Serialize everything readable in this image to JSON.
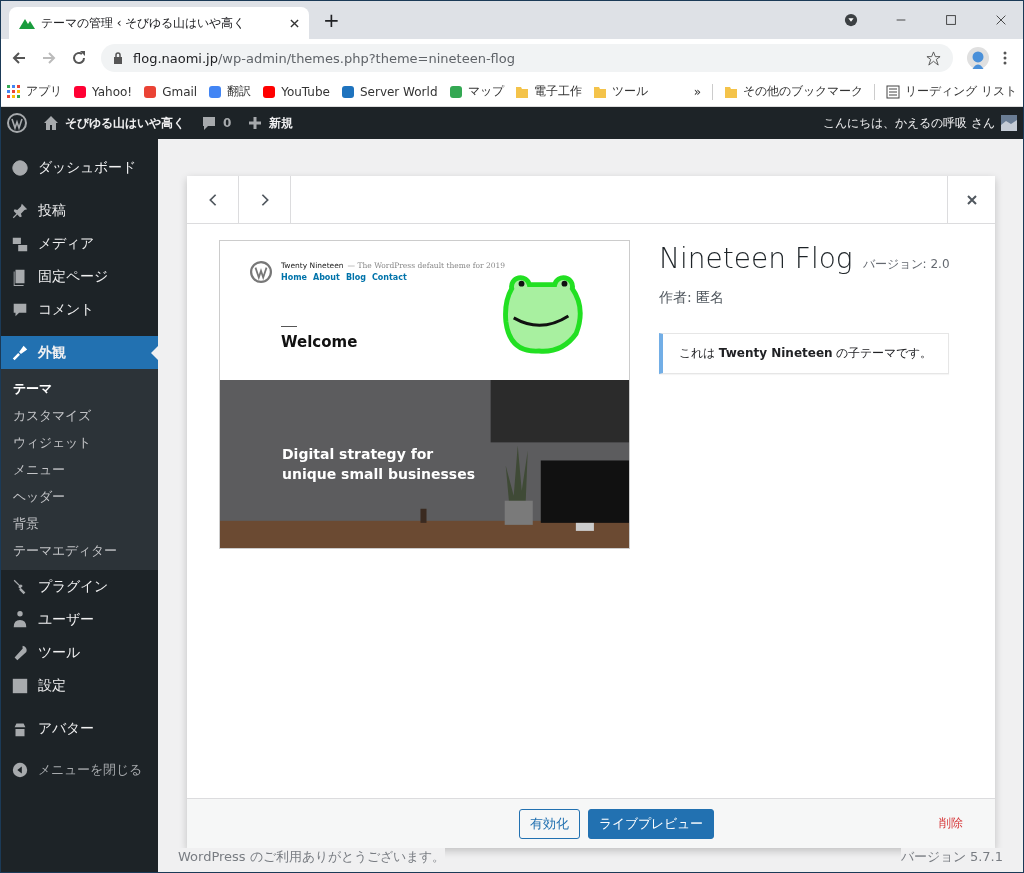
{
  "browser": {
    "tab_title": "テーマの管理 ‹ そびゆる山はいや高く",
    "new_tab": "+",
    "url_host": "flog.naomi.jp",
    "url_path": "/wp-admin/themes.php?theme=nineteen-flog",
    "bookmarks": [
      {
        "label": "アプリ",
        "kind": "apps"
      },
      {
        "label": "Yahoo!",
        "kind": "site",
        "color": "#ff0033"
      },
      {
        "label": "Gmail",
        "kind": "site",
        "color": "#ea4335"
      },
      {
        "label": "翻訳",
        "kind": "site",
        "color": "#4285f4"
      },
      {
        "label": "YouTube",
        "kind": "site",
        "color": "#ff0000"
      },
      {
        "label": "Server World",
        "kind": "site",
        "color": "#1e73be"
      },
      {
        "label": "マップ",
        "kind": "site",
        "color": "#34a853"
      },
      {
        "label": "電子工作",
        "kind": "folder"
      },
      {
        "label": "ツール",
        "kind": "folder"
      }
    ],
    "more": "»",
    "other_bookmarks": "その他のブックマーク",
    "reading_list": "リーディング リスト"
  },
  "admin_bar": {
    "site_name": "そびゆる山はいや高く",
    "comments": "0",
    "new": "新規",
    "greeting": "こんにちは、かえるの呼吸 さん"
  },
  "sidebar": {
    "items": [
      {
        "label": "ダッシュボード",
        "selected": false
      },
      {
        "label": "投稿",
        "selected": false
      },
      {
        "label": "メディア",
        "selected": false
      },
      {
        "label": "固定ページ",
        "selected": false
      },
      {
        "label": "コメント",
        "selected": false
      },
      {
        "label": "外観",
        "selected": true,
        "children": [
          {
            "label": "テーマ",
            "selected": true
          },
          {
            "label": "カスタマイズ",
            "selected": false
          },
          {
            "label": "ウィジェット",
            "selected": false
          },
          {
            "label": "メニュー",
            "selected": false
          },
          {
            "label": "ヘッダー",
            "selected": false
          },
          {
            "label": "背景",
            "selected": false
          },
          {
            "label": "テーマエディター",
            "selected": false
          }
        ]
      },
      {
        "label": "プラグイン",
        "selected": false
      },
      {
        "label": "ユーザー",
        "selected": false
      },
      {
        "label": "ツール",
        "selected": false
      },
      {
        "label": "設定",
        "selected": false
      },
      {
        "label": "アバター",
        "selected": false
      }
    ],
    "collapse": "メニューを閉じる"
  },
  "modal": {
    "preview": {
      "site_title": "Twenty Nineteen",
      "tagline": "— The WordPress default theme for 2019",
      "nav": [
        "Home",
        "About",
        "Blog",
        "Contact"
      ],
      "heading": "Welcome",
      "hero_text": "Digital strategy for unique small businesses"
    },
    "theme_name": "Nineteen Flog",
    "version": "バージョン: 2.0",
    "author": "作者: 匿名",
    "notice": "これは **Twenty Nineteen** の子テーマです。",
    "activate": "有効化",
    "live_preview": "ライブプレビュー",
    "delete": "削除"
  },
  "footer": {
    "thanks": "WordPress のご利用ありがとうございます。",
    "version": "バージョン 5.7.1"
  }
}
